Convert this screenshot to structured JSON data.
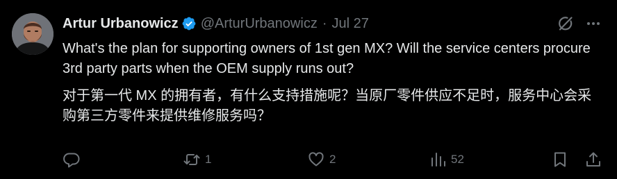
{
  "tweet": {
    "display_name": "Artur Urbanowicz",
    "handle": "@ArturUrbanowicz",
    "separator": "·",
    "date": "Jul 27",
    "text_en": "What's the plan for supporting owners of 1st gen MX? Will the service centers procure 3rd party parts when the OEM supply runs out?",
    "text_zh": "对于第一代 MX 的拥有者，有什么支持措施呢？当原厂零件供应不足时，服务中心会采购第三方零件来提供维修服务吗？"
  },
  "actions": {
    "reply_count": "",
    "retweet_count": "1",
    "like_count": "2",
    "views_count": "52"
  },
  "icons": {
    "verified": "verified-badge-icon",
    "grok": "grok-icon",
    "more": "more-icon",
    "reply": "reply-icon",
    "retweet": "retweet-icon",
    "like": "heart-icon",
    "views": "views-icon",
    "bookmark": "bookmark-icon",
    "share": "share-icon"
  },
  "colors": {
    "background": "#000000",
    "text_primary": "#e7e9ea",
    "text_secondary": "#71767b",
    "verified": "#1d9bf0"
  }
}
